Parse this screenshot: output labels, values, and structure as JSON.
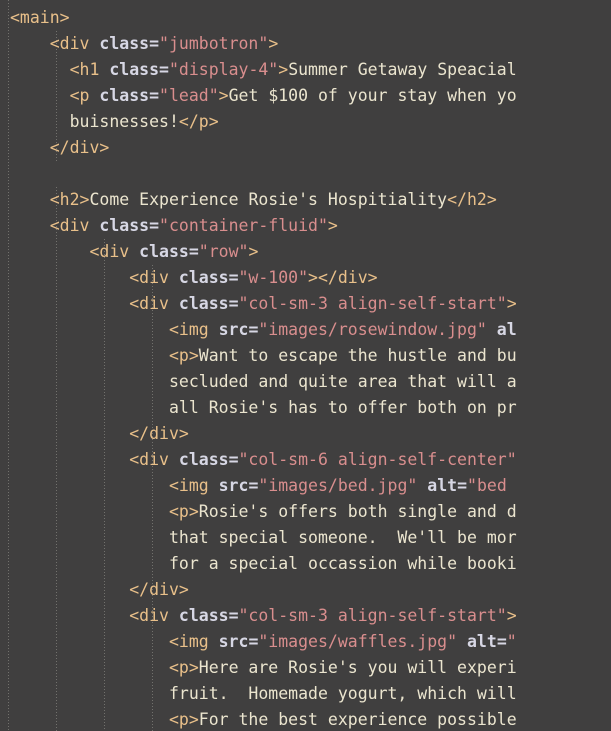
{
  "editor": {
    "kind": "code-editor",
    "language": "html",
    "colors": {
      "background": "#403f3f",
      "tag": "#e9c08a",
      "attribute_name": "#d7d7e4",
      "attribute_value": "#d98e8e",
      "text_content": "#ebe5cf",
      "indent_guide": "#9a9a92"
    },
    "indent_guides_x": [
      8,
      56,
      104,
      152
    ],
    "font_size_px": 16.5,
    "line_height_px": 26,
    "horizontal_scroll": "clipped-right"
  },
  "code_lines": [
    {
      "n": 1,
      "indent": 0,
      "tokens": [
        {
          "t": "tag",
          "v": "<main>"
        }
      ]
    },
    {
      "n": 2,
      "indent": 4,
      "tokens": [
        {
          "t": "tag",
          "v": "<div "
        },
        {
          "t": "attr",
          "v": "class"
        },
        {
          "t": "punct",
          "v": "="
        },
        {
          "t": "str",
          "v": "\"jumbotron\""
        },
        {
          "t": "tag",
          "v": ">"
        }
      ]
    },
    {
      "n": 3,
      "indent": 6,
      "tokens": [
        {
          "t": "tag",
          "v": "<h1 "
        },
        {
          "t": "attr",
          "v": "class"
        },
        {
          "t": "punct",
          "v": "="
        },
        {
          "t": "str",
          "v": "\"display-4\""
        },
        {
          "t": "tag",
          "v": ">"
        },
        {
          "t": "txt",
          "v": "Summer Getaway Speacial"
        }
      ]
    },
    {
      "n": 4,
      "indent": 6,
      "tokens": [
        {
          "t": "tag",
          "v": "<p "
        },
        {
          "t": "attr",
          "v": "class"
        },
        {
          "t": "punct",
          "v": "="
        },
        {
          "t": "str",
          "v": "\"lead\""
        },
        {
          "t": "tag",
          "v": ">"
        },
        {
          "t": "txt",
          "v": "Get $100 of your stay when yo"
        }
      ]
    },
    {
      "n": 5,
      "indent": 6,
      "tokens": [
        {
          "t": "txt",
          "v": "buisnesses!"
        },
        {
          "t": "tag",
          "v": "</p>"
        }
      ]
    },
    {
      "n": 6,
      "indent": 4,
      "tokens": [
        {
          "t": "tag",
          "v": "</div>"
        }
      ]
    },
    {
      "n": 7,
      "indent": 0,
      "tokens": []
    },
    {
      "n": 8,
      "indent": 4,
      "tokens": [
        {
          "t": "tag",
          "v": "<h2>"
        },
        {
          "t": "txt",
          "v": "Come Experience Rosie's Hospitiality"
        },
        {
          "t": "tag",
          "v": "</h2>"
        }
      ]
    },
    {
      "n": 9,
      "indent": 4,
      "tokens": [
        {
          "t": "tag",
          "v": "<div "
        },
        {
          "t": "attr",
          "v": "class"
        },
        {
          "t": "punct",
          "v": "="
        },
        {
          "t": "str",
          "v": "\"container-fluid\""
        },
        {
          "t": "tag",
          "v": ">"
        }
      ]
    },
    {
      "n": 10,
      "indent": 8,
      "tokens": [
        {
          "t": "tag",
          "v": "<div "
        },
        {
          "t": "attr",
          "v": "class"
        },
        {
          "t": "punct",
          "v": "="
        },
        {
          "t": "str",
          "v": "\"row\""
        },
        {
          "t": "tag",
          "v": ">"
        }
      ]
    },
    {
      "n": 11,
      "indent": 12,
      "tokens": [
        {
          "t": "tag",
          "v": "<div "
        },
        {
          "t": "attr",
          "v": "class"
        },
        {
          "t": "punct",
          "v": "="
        },
        {
          "t": "str",
          "v": "\"w-100\""
        },
        {
          "t": "tag",
          "v": "></div>"
        }
      ]
    },
    {
      "n": 12,
      "indent": 12,
      "tokens": [
        {
          "t": "tag",
          "v": "<div "
        },
        {
          "t": "attr",
          "v": "class"
        },
        {
          "t": "punct",
          "v": "="
        },
        {
          "t": "str",
          "v": "\"col-sm-3 align-self-start\""
        },
        {
          "t": "tag",
          "v": ">"
        }
      ]
    },
    {
      "n": 13,
      "indent": 16,
      "tokens": [
        {
          "t": "tag",
          "v": "<img "
        },
        {
          "t": "attr",
          "v": "src"
        },
        {
          "t": "punct",
          "v": "="
        },
        {
          "t": "str",
          "v": "\"images/rosewindow.jpg\""
        },
        {
          "t": "txt",
          "v": " "
        },
        {
          "t": "attr",
          "v": "al"
        }
      ]
    },
    {
      "n": 14,
      "indent": 16,
      "tokens": [
        {
          "t": "tag",
          "v": "<p>"
        },
        {
          "t": "txt",
          "v": "Want to escape the hustle and bu"
        }
      ]
    },
    {
      "n": 15,
      "indent": 16,
      "tokens": [
        {
          "t": "txt",
          "v": "secluded and quite area that will a"
        }
      ]
    },
    {
      "n": 16,
      "indent": 16,
      "tokens": [
        {
          "t": "txt",
          "v": "all Rosie's has to offer both on pr"
        }
      ]
    },
    {
      "n": 17,
      "indent": 12,
      "tokens": [
        {
          "t": "tag",
          "v": "</div>"
        }
      ]
    },
    {
      "n": 18,
      "indent": 12,
      "tokens": [
        {
          "t": "tag",
          "v": "<div "
        },
        {
          "t": "attr",
          "v": "class"
        },
        {
          "t": "punct",
          "v": "="
        },
        {
          "t": "str",
          "v": "\"col-sm-6 align-self-center\""
        }
      ]
    },
    {
      "n": 19,
      "indent": 16,
      "tokens": [
        {
          "t": "tag",
          "v": "<img "
        },
        {
          "t": "attr",
          "v": "src"
        },
        {
          "t": "punct",
          "v": "="
        },
        {
          "t": "str",
          "v": "\"images/bed.jpg\""
        },
        {
          "t": "txt",
          "v": " "
        },
        {
          "t": "attr",
          "v": "alt"
        },
        {
          "t": "punct",
          "v": "="
        },
        {
          "t": "str",
          "v": "\"bed"
        }
      ]
    },
    {
      "n": 20,
      "indent": 16,
      "tokens": [
        {
          "t": "tag",
          "v": "<p>"
        },
        {
          "t": "txt",
          "v": "Rosie's offers both single and d"
        }
      ]
    },
    {
      "n": 21,
      "indent": 16,
      "tokens": [
        {
          "t": "txt",
          "v": "that special someone.  We'll be mor"
        }
      ]
    },
    {
      "n": 22,
      "indent": 16,
      "tokens": [
        {
          "t": "txt",
          "v": "for a special occassion while booki"
        }
      ]
    },
    {
      "n": 23,
      "indent": 12,
      "tokens": [
        {
          "t": "tag",
          "v": "</div>"
        }
      ]
    },
    {
      "n": 24,
      "indent": 12,
      "tokens": [
        {
          "t": "tag",
          "v": "<div "
        },
        {
          "t": "attr",
          "v": "class"
        },
        {
          "t": "punct",
          "v": "="
        },
        {
          "t": "str",
          "v": "\"col-sm-3 align-self-start\""
        },
        {
          "t": "tag",
          "v": ">"
        }
      ]
    },
    {
      "n": 25,
      "indent": 16,
      "tokens": [
        {
          "t": "tag",
          "v": "<img "
        },
        {
          "t": "attr",
          "v": "src"
        },
        {
          "t": "punct",
          "v": "="
        },
        {
          "t": "str",
          "v": "\"images/waffles.jpg\""
        },
        {
          "t": "txt",
          "v": " "
        },
        {
          "t": "attr",
          "v": "alt"
        },
        {
          "t": "punct",
          "v": "="
        },
        {
          "t": "str",
          "v": "\""
        }
      ]
    },
    {
      "n": 26,
      "indent": 16,
      "tokens": [
        {
          "t": "tag",
          "v": "<p>"
        },
        {
          "t": "txt",
          "v": "Here are Rosie's you will experi"
        }
      ]
    },
    {
      "n": 27,
      "indent": 16,
      "tokens": [
        {
          "t": "txt",
          "v": "fruit.  Homemade yogurt, which will"
        }
      ]
    },
    {
      "n": 28,
      "indent": 16,
      "tokens": [
        {
          "t": "tag",
          "v": "<p>"
        },
        {
          "t": "txt",
          "v": "For the best experience possible"
        }
      ]
    }
  ]
}
